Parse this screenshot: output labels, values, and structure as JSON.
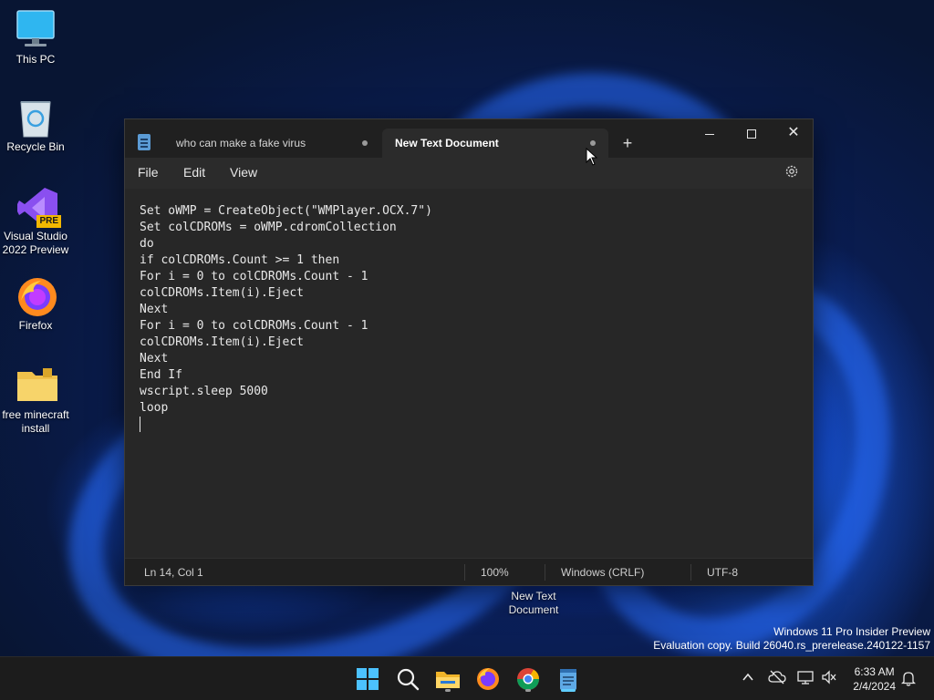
{
  "desktop": {
    "icons": [
      {
        "label": "This PC"
      },
      {
        "label": "Recycle Bin"
      },
      {
        "label": "Visual Studio 2022 Preview",
        "badge": "PRE"
      },
      {
        "label": "Firefox"
      },
      {
        "label": "free minecraft install"
      }
    ],
    "document_label": "New Text Document",
    "watermark": {
      "line1": "Windows 11 Pro Insider Preview",
      "line2": "Evaluation copy. Build 26040.rs_prerelease.240122-1157"
    }
  },
  "notepad": {
    "tabs": [
      {
        "label": "who can make a fake virus",
        "unsaved": true
      },
      {
        "label": "New Text Document",
        "unsaved": true,
        "active": true
      }
    ],
    "new_tab": "+",
    "menu": {
      "file": "File",
      "edit": "Edit",
      "view": "View"
    },
    "lines": [
      "Set oWMP = CreateObject(\"WMPlayer.OCX.7\")",
      "Set colCDROMs = oWMP.cdromCollection",
      "do",
      "if colCDROMs.Count >= 1 then",
      "For i = 0 to colCDROMs.Count - 1",
      "colCDROMs.Item(i).Eject",
      "Next",
      "For i = 0 to colCDROMs.Count - 1",
      "colCDROMs.Item(i).Eject",
      "Next",
      "End If",
      "wscript.sleep 5000",
      "loop"
    ],
    "status": {
      "position": "Ln 14, Col 1",
      "zoom": "100%",
      "line_ending": "Windows (CRLF)",
      "encoding": "UTF-8"
    }
  },
  "taskbar": {
    "apps": [
      "start-icon",
      "search-icon",
      "file-explorer-icon",
      "firefox-icon",
      "chrome-icon",
      "notepad-icon"
    ],
    "clock": {
      "time": "6:33 AM",
      "date": "2/4/2024"
    }
  },
  "colors": {
    "accent": "#60cdff",
    "window_bg": "#272727",
    "titlebar_bg": "#202020"
  }
}
